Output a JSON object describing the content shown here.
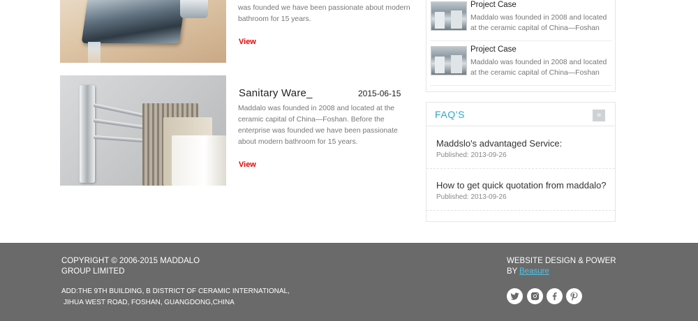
{
  "products": [
    {
      "desc": "was founded we have been passionate about modern bathroom for 15 years.",
      "view_label": "View"
    },
    {
      "title": "Sanitary Ware_",
      "date": "2015-06-15",
      "desc": "Maddalo was founded in 2008 and located at the ceramic capital of China—Foshan. Before the enterprise was founded we have been passionate about modern bathroom for 15 years.",
      "view_label": "View"
    }
  ],
  "cases": [
    {
      "title": "Project Case",
      "desc": "Maddalo was founded in 2008 and located at the ceramic capital of China—Foshan"
    },
    {
      "title": "Project Case",
      "desc": "Maddalo was founded in 2008 and located at the ceramic capital of China—Foshan"
    }
  ],
  "faq": {
    "title": "FAQ'S",
    "more_label": "»",
    "items": [
      {
        "question": "Maddslo's advantaged Service:",
        "published": "Published: 2013-09-26"
      },
      {
        "question": "How to get quick quotation from maddalo?",
        "published": "Published: 2013-09-26"
      }
    ]
  },
  "footer": {
    "copyright": "COPYRIGHT © 2006-2015 MADDALO GROUP LIMITED",
    "address_line1": "ADD:THE 9TH BUILDING, B DISTRICT OF CERAMIC INTERNATIONAL,",
    "address_line2": "JIHUA WEST ROAD, FOSHAN, GUANGDONG,CHINA",
    "design_text": "WEBSITE DESIGN & POWER BY",
    "design_link": "Beasure",
    "social_icons": [
      "twitter-icon",
      "instagram-icon",
      "facebook-icon",
      "pinterest-icon"
    ]
  },
  "colors": {
    "accent": "#2aa7c9",
    "view_red": "#e60000",
    "footer_bg": "#6a6a6a",
    "link": "#4fc4e6"
  }
}
